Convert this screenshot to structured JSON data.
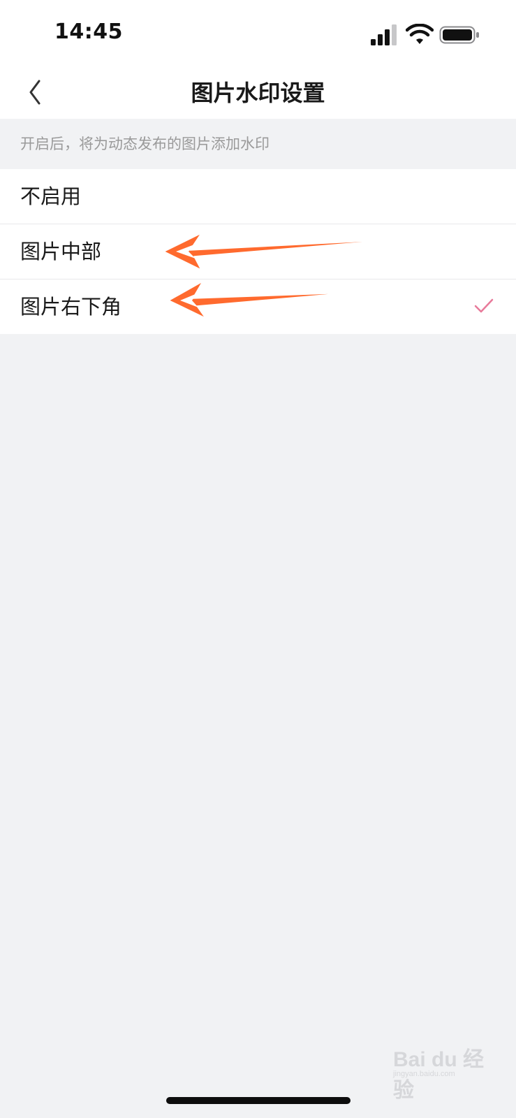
{
  "status_bar": {
    "time": "14:45"
  },
  "nav": {
    "title": "图片水印设置",
    "back_icon": "chevron-left-icon"
  },
  "hint": "开启后，将为动态发布的图片添加水印",
  "options": [
    {
      "label": "不启用",
      "selected": false
    },
    {
      "label": "图片中部",
      "selected": false
    },
    {
      "label": "图片右下角",
      "selected": true
    }
  ],
  "colors": {
    "check": "#e87a9a",
    "annotation_arrow": "#ff6a2e",
    "background": "#f1f2f4"
  },
  "watermark": {
    "text": "Bai du 经验",
    "sub": "jingyan.baidu.com"
  }
}
